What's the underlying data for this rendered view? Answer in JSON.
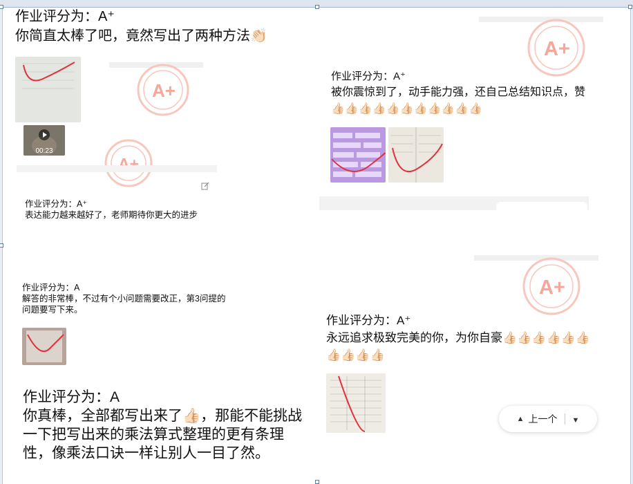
{
  "cards": [
    {
      "grade": "作业评分为：A⁺",
      "comment": "你简直太棒了吧，竟然写出了两种方法👏🏻"
    },
    {
      "grade": "作业评分为：A⁺",
      "comment": "被你震惊到了，动手能力强，还自己总结知识点，赞👍🏻👍🏻👍🏻👍🏻👍🏻👍🏻👍🏻👍🏻👍🏻👍🏻👍🏻"
    },
    {
      "grade": "作业评分为：A⁺",
      "comment": "表达能力越来越好了，老师期待你更大的进步"
    },
    {
      "grade": "作业评分为：A",
      "comment": "解答的非常棒，不过有个小问题需要改正，第3问提的问题要写下来。"
    },
    {
      "grade": "作业评分为：A⁺",
      "comment": "永远追求极致完美的你，为你自豪👍🏻👍🏻👍🏻👍🏻👍🏻👍🏻👍🏻👍🏻👍🏻👍🏻"
    },
    {
      "grade": "作业评分为：A",
      "comment": "你真棒，全部都写出来了👍🏻，那能不能挑战一下把写出来的乘法算式整理的更有条理性，像乘法口诀一样让别人一目了然。"
    }
  ],
  "video": {
    "duration": "00:23"
  },
  "stamp": {
    "text": "A+"
  },
  "nav": {
    "prev_label": "上一个"
  },
  "colors": {
    "stamp": "#f2a596",
    "stamp_text": "#f4a89a",
    "line": "#e0313a"
  }
}
